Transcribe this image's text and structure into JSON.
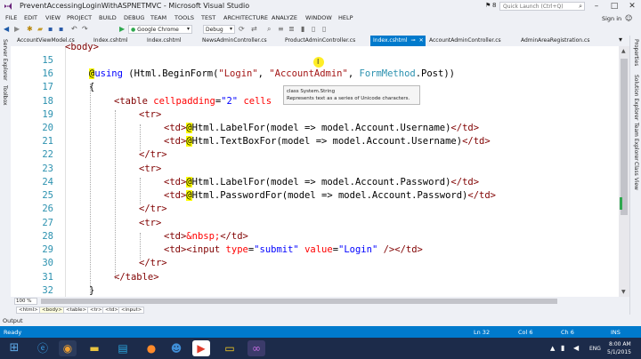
{
  "window": {
    "title": "PreventAccessingLoginWithASPNETMVC - Microsoft Visual Studio",
    "notifications": "8",
    "quick_launch_placeholder": "Quick Launch (Ctrl+Q)",
    "sign_in": "Sign in"
  },
  "menu": [
    "FILE",
    "EDIT",
    "VIEW",
    "PROJECT",
    "BUILD",
    "DEBUG",
    "TEAM",
    "TOOLS",
    "TEST",
    "ARCHITECTURE",
    "ANALYZE",
    "WINDOW",
    "HELP"
  ],
  "toolbar": {
    "browser": "Google Chrome",
    "configuration": "Debug"
  },
  "side_panels": {
    "left": [
      "Server Explorer",
      "Toolbox"
    ],
    "right": [
      "Properties",
      "Solution Explorer",
      "Team Explorer",
      "Class View"
    ]
  },
  "tabs": [
    {
      "label": "AccountViewModel.cs",
      "active": false
    },
    {
      "label": "Index.cshtml",
      "active": false
    },
    {
      "label": "Index.cshtml",
      "active": false
    },
    {
      "label": "NewsAdminController.cs",
      "active": false
    },
    {
      "label": "ProductAdminController.cs",
      "active": false
    },
    {
      "label": "Index.cshtml",
      "active": true
    },
    {
      "label": "AccountAdminController.cs",
      "active": false
    },
    {
      "label": "AdminAreaRegistration.cs",
      "active": false
    }
  ],
  "editor": {
    "partial_line": "<body>",
    "line_numbers": [
      "15",
      "16",
      "17",
      "18",
      "19",
      "20",
      "21",
      "22",
      "23",
      "24",
      "25",
      "26",
      "27",
      "28",
      "29",
      "30",
      "31",
      "32"
    ]
  },
  "tooltip": {
    "line1": "class System.String",
    "line2": "Represents text as a series of Unicode characters."
  },
  "zoom": "100 %",
  "breadcrumb": [
    "<html>",
    "<body>",
    "<table>",
    "<tr>",
    "<td>",
    "<input>"
  ],
  "output_label": "Output",
  "status": {
    "text": "Ready",
    "line": "Ln 32",
    "col": "Col 6",
    "ch": "Ch 6",
    "mode": "INS"
  },
  "taskbar": {
    "language": "ENG",
    "time": "8:00 AM",
    "date": "5/1/2015"
  },
  "colors": {
    "accent": "#007acc",
    "chrome": "#eef0f5",
    "taskbar": "#1c2b4a"
  }
}
